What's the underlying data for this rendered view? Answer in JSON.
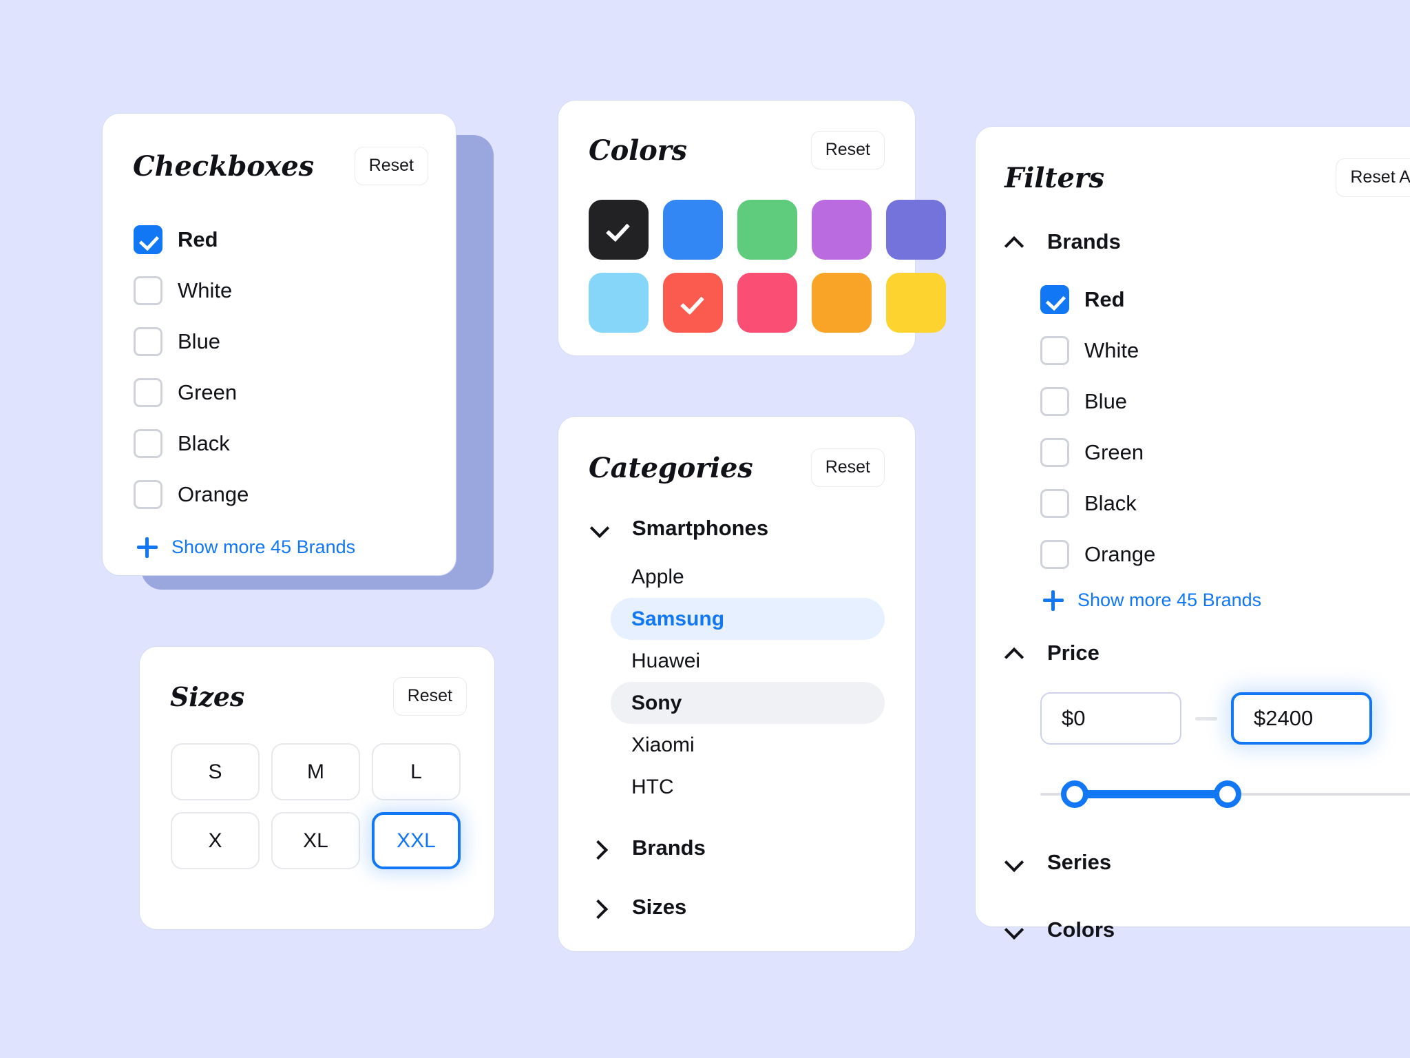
{
  "theme": {
    "background": "#E0E3FD",
    "accent": "#1277F4",
    "shadow_card": "#9AA7DF",
    "card_border": "#D6DBF5"
  },
  "checkboxes_panel": {
    "title": "Checkboxes",
    "reset_label": "Reset",
    "options": [
      {
        "label": "Red",
        "checked": true
      },
      {
        "label": "White",
        "checked": false
      },
      {
        "label": "Blue",
        "checked": false
      },
      {
        "label": "Green",
        "checked": false
      },
      {
        "label": "Black",
        "checked": false
      },
      {
        "label": "Orange",
        "checked": false
      }
    ],
    "show_more_label": "Show more 45 Brands"
  },
  "sizes_panel": {
    "title": "Sizes",
    "reset_label": "Reset",
    "sizes": [
      {
        "label": "S",
        "selected": false
      },
      {
        "label": "M",
        "selected": false
      },
      {
        "label": "L",
        "selected": false
      },
      {
        "label": "X",
        "selected": false
      },
      {
        "label": "XL",
        "selected": false
      },
      {
        "label": "XXL",
        "selected": true
      }
    ]
  },
  "colors_panel": {
    "title": "Colors",
    "reset_label": "Reset",
    "swatches": [
      {
        "name": "black",
        "hex": "#222225",
        "checked": true
      },
      {
        "name": "blue",
        "hex": "#3387F5",
        "checked": false
      },
      {
        "name": "green",
        "hex": "#5FCB7C",
        "checked": false
      },
      {
        "name": "orchid",
        "hex": "#BB6BE0",
        "checked": false
      },
      {
        "name": "indigo",
        "hex": "#7472DB",
        "checked": false
      },
      {
        "name": "sky",
        "hex": "#85D6F8",
        "checked": false
      },
      {
        "name": "tomato",
        "hex": "#FB5B4E",
        "checked": true
      },
      {
        "name": "pink",
        "hex": "#FB4E74",
        "checked": false
      },
      {
        "name": "orange",
        "hex": "#FAA427",
        "checked": false
      },
      {
        "name": "yellow",
        "hex": "#FCD32F",
        "checked": false
      }
    ]
  },
  "categories_panel": {
    "title": "Categories",
    "reset_label": "Reset",
    "groups": [
      {
        "label": "Smartphones",
        "state": "expanded",
        "items": [
          {
            "label": "Apple",
            "state": "normal"
          },
          {
            "label": "Samsung",
            "state": "active"
          },
          {
            "label": "Huawei",
            "state": "normal"
          },
          {
            "label": "Sony",
            "state": "hover"
          },
          {
            "label": "Xiaomi",
            "state": "normal"
          },
          {
            "label": "HTC",
            "state": "normal"
          }
        ]
      },
      {
        "label": "Brands",
        "state": "collapsed",
        "items": []
      },
      {
        "label": "Sizes",
        "state": "collapsed",
        "items": []
      }
    ]
  },
  "filters_panel": {
    "title": "Filters",
    "reset_all_label": "Reset All",
    "brands": {
      "label": "Brands",
      "options": [
        {
          "label": "Red",
          "checked": true
        },
        {
          "label": "White",
          "checked": false
        },
        {
          "label": "Blue",
          "checked": false
        },
        {
          "label": "Green",
          "checked": false
        },
        {
          "label": "Black",
          "checked": false
        },
        {
          "label": "Orange",
          "checked": false
        }
      ],
      "show_more_label": "Show more 45 Brands"
    },
    "price": {
      "label": "Price",
      "min_value": "$0",
      "max_value": "$2400",
      "min_placeholder": "$0",
      "max_placeholder": "$2400",
      "separator": "—"
    },
    "series": {
      "label": "Series"
    },
    "colors": {
      "label": "Colors"
    }
  }
}
